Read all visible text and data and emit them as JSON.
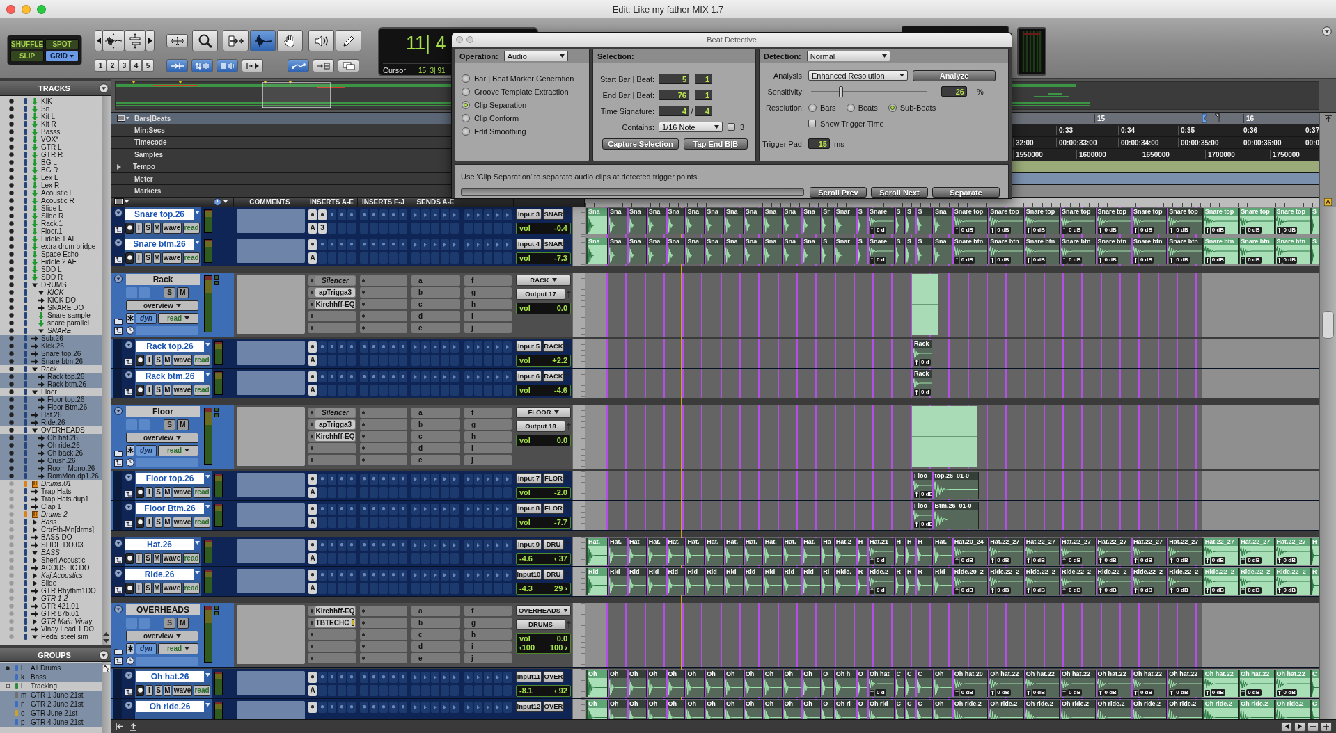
{
  "window": {
    "title": "Edit: Like my father MIX 1.7"
  },
  "toolbar": {
    "edit_modes": [
      {
        "label": "SHUFFLE",
        "selected": false
      },
      {
        "label": "SPOT",
        "selected": false
      },
      {
        "label": "SLIP",
        "selected": false
      },
      {
        "label": "GRID",
        "selected": true
      }
    ],
    "zoom_presets": [
      "1",
      "2",
      "3",
      "4",
      "5"
    ],
    "tools": [
      {
        "kind": "zoom",
        "selected": false
      },
      {
        "kind": "trim",
        "selected": false
      },
      {
        "kind": "select",
        "selected": true
      },
      {
        "kind": "grab",
        "selected": false
      },
      {
        "kind": "scrub",
        "selected": false
      },
      {
        "kind": "pencil",
        "selected": false
      }
    ],
    "options": [
      {
        "kind": "tab",
        "on": true
      },
      {
        "kind": "nudge",
        "on": true
      },
      {
        "kind": "spread",
        "on": true
      },
      {
        "kind": "insert",
        "on": false
      },
      {
        "kind": "link",
        "on": true
      },
      {
        "kind": "arrow-box",
        "on": false
      },
      {
        "kind": "windows",
        "on": false
      }
    ],
    "counter": {
      "main": "11| 4",
      "label": "Cursor",
      "cursor": "15| 3| 91"
    }
  },
  "tracks_panel": {
    "title": "TRACKS",
    "items": [
      {
        "name": "KiK",
        "kind": "aux",
        "shown": true,
        "selected": false,
        "inactive": false
      },
      {
        "name": "Sn",
        "kind": "aux",
        "shown": true,
        "selected": false,
        "inactive": false
      },
      {
        "name": "Kit L",
        "kind": "aux",
        "shown": true,
        "selected": false,
        "inactive": false
      },
      {
        "name": "Kit R",
        "kind": "aux",
        "shown": true,
        "selected": false,
        "inactive": false
      },
      {
        "name": "Basss",
        "kind": "aux",
        "shown": true,
        "selected": false,
        "inactive": false
      },
      {
        "name": "VOX*",
        "kind": "aux",
        "shown": true,
        "selected": false,
        "inactive": false
      },
      {
        "name": "GTR L",
        "kind": "aux",
        "shown": true,
        "selected": false,
        "inactive": false
      },
      {
        "name": "GTR R",
        "kind": "aux",
        "shown": true,
        "selected": false,
        "inactive": false
      },
      {
        "name": "BG L",
        "kind": "aux",
        "shown": true,
        "selected": false,
        "inactive": false
      },
      {
        "name": "BG R",
        "kind": "aux",
        "shown": true,
        "selected": false,
        "inactive": false
      },
      {
        "name": "Lex L",
        "kind": "aux",
        "shown": true,
        "selected": false,
        "inactive": false
      },
      {
        "name": "Lex R",
        "kind": "aux",
        "shown": true,
        "selected": false,
        "inactive": false
      },
      {
        "name": "Acoustic L",
        "kind": "aux",
        "shown": true,
        "selected": false,
        "inactive": false
      },
      {
        "name": "Acoustic R",
        "kind": "aux",
        "shown": true,
        "selected": false,
        "inactive": false
      },
      {
        "name": "Slide L",
        "kind": "aux",
        "shown": true,
        "selected": false,
        "inactive": false
      },
      {
        "name": "Slide R",
        "kind": "aux",
        "shown": true,
        "selected": false,
        "inactive": false
      },
      {
        "name": "Rack.1",
        "kind": "aux",
        "shown": true,
        "selected": false,
        "inactive": false
      },
      {
        "name": "Floor.1",
        "kind": "aux",
        "shown": true,
        "selected": false,
        "inactive": false
      },
      {
        "name": "Fiddle 1 AF",
        "kind": "aux",
        "shown": true,
        "selected": false,
        "inactive": false
      },
      {
        "name": "extra drum bridge",
        "kind": "aux",
        "shown": true,
        "selected": false,
        "inactive": false
      },
      {
        "name": "Space Echo",
        "kind": "aux",
        "shown": true,
        "selected": false,
        "inactive": false
      },
      {
        "name": "Fiddle 2 AF",
        "kind": "aux",
        "shown": true,
        "selected": false,
        "inactive": false
      },
      {
        "name": "SDD L",
        "kind": "aux",
        "shown": true,
        "selected": false,
        "inactive": false
      },
      {
        "name": "SDD R",
        "kind": "aux",
        "shown": true,
        "selected": false,
        "inactive": false
      },
      {
        "name": "DRUMS",
        "kind": "folder",
        "shown": true,
        "selected": false,
        "inactive": false,
        "expanded": true,
        "children": [
          {
            "name": "KICK",
            "kind": "folder",
            "shown": true,
            "selected": false,
            "inactive": true,
            "expanded": true
          },
          {
            "name": "KICK DO",
            "kind": "audio",
            "shown": true,
            "selected": false,
            "inactive": false
          },
          {
            "name": "SNARE DO",
            "kind": "audio",
            "shown": true,
            "selected": false,
            "inactive": false
          },
          {
            "name": "Snare sample",
            "kind": "aux",
            "shown": true,
            "selected": false,
            "inactive": false
          },
          {
            "name": "snare parallel",
            "kind": "aux",
            "shown": true,
            "selected": false,
            "inactive": false
          },
          {
            "name": "SNARE",
            "kind": "folder",
            "shown": true,
            "selected": false,
            "inactive": true,
            "expanded": true
          }
        ]
      },
      {
        "name": "Sub.26",
        "kind": "audio",
        "shown": true,
        "selected": true,
        "inactive": false
      },
      {
        "name": "Kick.26",
        "kind": "audio",
        "shown": true,
        "selected": true,
        "inactive": false
      },
      {
        "name": "Snare top.26",
        "kind": "audio",
        "shown": true,
        "selected": true,
        "inactive": false
      },
      {
        "name": "Snare btm.26",
        "kind": "audio",
        "shown": true,
        "selected": true,
        "inactive": false
      },
      {
        "name": "Rack",
        "kind": "folder",
        "shown": true,
        "selected": false,
        "inactive": false,
        "expanded": true,
        "children": [
          {
            "name": "Rack top.26",
            "kind": "audio",
            "shown": true,
            "selected": true,
            "inactive": false
          },
          {
            "name": "Rack btm.26",
            "kind": "audio",
            "shown": true,
            "selected": true,
            "inactive": false
          }
        ]
      },
      {
        "name": "Floor",
        "kind": "folder",
        "shown": true,
        "selected": false,
        "inactive": false,
        "expanded": true,
        "children": [
          {
            "name": "Floor top.26",
            "kind": "audio",
            "shown": true,
            "selected": true,
            "inactive": false
          },
          {
            "name": "Floor Btm.26",
            "kind": "audio",
            "shown": true,
            "selected": true,
            "inactive": false
          }
        ]
      },
      {
        "name": "Hat.26",
        "kind": "audio",
        "shown": true,
        "selected": true,
        "inactive": false
      },
      {
        "name": "Ride.26",
        "kind": "audio",
        "shown": true,
        "selected": true,
        "inactive": false
      },
      {
        "name": "OVERHEADS",
        "kind": "folder",
        "shown": true,
        "selected": false,
        "inactive": false,
        "expanded": true,
        "children": [
          {
            "name": "Oh hat.26",
            "kind": "audio",
            "shown": true,
            "selected": true,
            "inactive": false
          },
          {
            "name": "Oh ride.26",
            "kind": "audio",
            "shown": true,
            "selected": true,
            "inactive": false
          },
          {
            "name": "Oh back.26",
            "kind": "audio",
            "shown": true,
            "selected": true,
            "inactive": false
          },
          {
            "name": "Crush.26",
            "kind": "audio",
            "shown": true,
            "selected": true,
            "inactive": false
          },
          {
            "name": "Room Mono.26",
            "kind": "audio",
            "shown": true,
            "selected": true,
            "inactive": false
          },
          {
            "name": "RomMon.dp1.26",
            "kind": "audio",
            "shown": true,
            "selected": true,
            "inactive": false
          }
        ]
      },
      {
        "name": "Drums.01",
        "kind": "instrument",
        "shown": false,
        "selected": false,
        "inactive": true
      },
      {
        "name": "Trap Hats",
        "kind": "audio",
        "shown": false,
        "selected": false,
        "inactive": false
      },
      {
        "name": "Trap Hats.dup1",
        "kind": "audio",
        "shown": false,
        "selected": false,
        "inactive": false
      },
      {
        "name": "Clap 1",
        "kind": "audio",
        "shown": false,
        "selected": false,
        "inactive": false
      },
      {
        "name": "Drums 2",
        "kind": "instrument",
        "shown": false,
        "selected": false,
        "inactive": true
      },
      {
        "name": "Bass",
        "kind": "folder",
        "shown": false,
        "selected": false,
        "inactive": true,
        "expanded": false
      },
      {
        "name": "CrtrFth-Mn[drms]",
        "kind": "folder",
        "shown": false,
        "selected": false,
        "inactive": false,
        "expanded": false
      },
      {
        "name": "BASS DO",
        "kind": "audio",
        "shown": false,
        "selected": false,
        "inactive": false
      },
      {
        "name": "SLIDE DO.03",
        "kind": "audio",
        "shown": false,
        "selected": false,
        "inactive": false
      },
      {
        "name": "BASS",
        "kind": "folder",
        "shown": false,
        "selected": false,
        "inactive": true,
        "expanded": true
      },
      {
        "name": "Sheri Acoustic",
        "kind": "folder",
        "shown": false,
        "selected": false,
        "inactive": false,
        "expanded": false
      },
      {
        "name": "ACOUSTIC DO",
        "kind": "audio",
        "shown": false,
        "selected": false,
        "inactive": false
      },
      {
        "name": "Kaj Acoustics",
        "kind": "folder",
        "shown": false,
        "selected": false,
        "inactive": true,
        "expanded": false
      },
      {
        "name": "Slide",
        "kind": "folder",
        "shown": false,
        "selected": false,
        "inactive": false,
        "expanded": false
      },
      {
        "name": "GTR Rhythm1DO",
        "kind": "audio",
        "shown": false,
        "selected": false,
        "inactive": false
      },
      {
        "name": "GTR 1-2",
        "kind": "folder",
        "shown": false,
        "selected": false,
        "inactive": true,
        "expanded": false
      },
      {
        "name": "GTR 421.01",
        "kind": "audio",
        "shown": false,
        "selected": false,
        "inactive": false
      },
      {
        "name": "GTR 87b.01",
        "kind": "audio",
        "shown": false,
        "selected": false,
        "inactive": false
      },
      {
        "name": "GTR Main Vinay",
        "kind": "folder",
        "shown": false,
        "selected": false,
        "inactive": true,
        "expanded": false
      },
      {
        "name": "Vinay Lead 1 DO",
        "kind": "audio",
        "shown": false,
        "selected": false,
        "inactive": false
      },
      {
        "name": "Pedal steel sim",
        "kind": "folder",
        "shown": false,
        "selected": false,
        "inactive": false,
        "expanded": true
      }
    ]
  },
  "groups_panel": {
    "title": "GROUPS",
    "items": [
      {
        "letter": "i",
        "name": "All Drums",
        "selected": true,
        "kind": "active",
        "color": "#3d6fc0"
      },
      {
        "letter": "k",
        "name": "Bass",
        "selected": true,
        "kind": "plain",
        "color": "#3d6fc0"
      },
      {
        "letter": "l",
        "name": "Tracking",
        "selected": false,
        "kind": "inactive",
        "color": "#2e8b3e"
      },
      {
        "letter": "m",
        "name": "GTR 1 June 21st",
        "selected": true,
        "kind": "plain",
        "color": "#707070"
      },
      {
        "letter": "n",
        "name": "GTR 2 June 21st",
        "selected": true,
        "kind": "plain",
        "color": "#3d6fc0"
      },
      {
        "letter": "o",
        "name": "GTR June 21st",
        "selected": true,
        "kind": "plain",
        "color": "#c9a227"
      },
      {
        "letter": "p",
        "name": "GTR 4 June 21st",
        "selected": true,
        "kind": "plain",
        "color": "#3d6fc0"
      }
    ]
  },
  "rulers": [
    {
      "label": "Bars|Beats",
      "kind": "bars",
      "selected": true,
      "ticks": [
        "15",
        "16"
      ]
    },
    {
      "label": "Min:Secs",
      "kind": "minsecs",
      "selected": false,
      "ticks": [
        "0:33",
        "0:34",
        "0:35",
        "0:36",
        "0:37"
      ]
    },
    {
      "label": "Timecode",
      "kind": "timecode",
      "selected": false,
      "ticks": [
        "32:00",
        "00:00:33:00",
        "00:00:34:00",
        "00:00:35:00",
        "00:00:36:00",
        "00:0"
      ]
    },
    {
      "label": "Samples",
      "kind": "samples",
      "selected": false,
      "ticks": [
        "1550000",
        "1600000",
        "1650000",
        "1700000",
        "1750000"
      ]
    },
    {
      "label": "Tempo",
      "kind": "tempo",
      "selected": false
    },
    {
      "label": "Meter",
      "kind": "meter",
      "selected": false
    },
    {
      "label": "Markers",
      "kind": "markers",
      "selected": false
    }
  ],
  "columns": [
    "COMMENTS",
    "INSERTS A-E",
    "INSERTS F-J",
    "SENDS A-E"
  ],
  "tracks": [
    {
      "kind": "audio",
      "name": "Snare top.26",
      "selected": true,
      "armed": false,
      "buttons": [
        {
          "label": "I",
          "on": false
        },
        {
          "label": "S",
          "on": false
        },
        {
          "label": "M",
          "on": false
        }
      ],
      "view": "wave",
      "automation": "read",
      "insert_marks": [
        "A",
        "3"
      ],
      "input": "Input 3",
      "output": "SNAR",
      "volume_label": "vol",
      "volume": "-0.4",
      "clips": [
        {
          "label": "Sna"
        },
        {
          "label": "Sna"
        },
        {
          "label": "Sna"
        },
        {
          "label": "Sna"
        },
        {
          "label": "Sna"
        },
        {
          "label": "Sna"
        },
        {
          "label": "Sna"
        },
        {
          "label": "Sna"
        },
        {
          "label": "Sna"
        },
        {
          "label": "Sna"
        },
        {
          "label": "Sna"
        },
        {
          "label": "Sna"
        },
        {
          "label": "Sr"
        },
        {
          "label": "Snar"
        },
        {
          "label": "S"
        },
        {
          "label": "Snare",
          "gain": "0 d"
        },
        {
          "label": "S"
        },
        {
          "label": "S"
        },
        {
          "label": "S"
        },
        {
          "label": "Sna"
        },
        {
          "label": "Snare top",
          "gain": "0 dB"
        },
        {
          "label": "Snare top",
          "gain": "0 dB"
        },
        {
          "label": "Snare top",
          "gain": "0 dB"
        },
        {
          "label": "Snare top",
          "gain": "0 dB"
        },
        {
          "label": "Snare top",
          "gain": "0 dB"
        },
        {
          "label": "Snare top",
          "gain": "0 dB"
        },
        {
          "label": "Snare top",
          "gain": "0 dB"
        },
        {
          "label": "Snare top",
          "gain": "0 dB"
        },
        {
          "label": "Snare top",
          "gain": "0 dB"
        },
        {
          "label": "Snare top",
          "gain": "0 dB"
        },
        {
          "label": "S"
        }
      ]
    },
    {
      "kind": "audio",
      "name": "Snare btm.26",
      "selected": true,
      "armed": false,
      "buttons": [
        {
          "label": "I",
          "on": false
        },
        {
          "label": "S",
          "on": false
        },
        {
          "label": "M",
          "on": false
        }
      ],
      "view": "wave",
      "automation": "read",
      "insert_marks": [
        "A"
      ],
      "input": "Input 4",
      "output": "SNAR",
      "volume_label": "vol",
      "volume": "-7.3",
      "clips": [
        {
          "label": "Sna"
        },
        {
          "label": "Sna"
        },
        {
          "label": "Sna"
        },
        {
          "label": "Sna"
        },
        {
          "label": "Sna"
        },
        {
          "label": "Sna"
        },
        {
          "label": "Sna"
        },
        {
          "label": "Sna"
        },
        {
          "label": "Sna"
        },
        {
          "label": "Sna"
        },
        {
          "label": "Sna"
        },
        {
          "label": "Sna"
        },
        {
          "label": "S"
        },
        {
          "label": "Snar"
        },
        {
          "label": "S"
        },
        {
          "label": "Snare",
          "gain": "0 d"
        },
        {
          "label": "S"
        },
        {
          "label": "S"
        },
        {
          "label": "S"
        },
        {
          "label": "Sna"
        },
        {
          "label": "Snare btn",
          "gain": "0 dB"
        },
        {
          "label": "Snare btn",
          "gain": "0 dB"
        },
        {
          "label": "Snare btn",
          "gain": "0 dB"
        },
        {
          "label": "Snare btn",
          "gain": "0 dB"
        },
        {
          "label": "Snare btn",
          "gain": "0 dB"
        },
        {
          "label": "Snare btn",
          "gain": "0 dB"
        },
        {
          "label": "Snare btn",
          "gain": "0 dB"
        },
        {
          "label": "Snare btn",
          "gain": "0 dB"
        },
        {
          "label": "Snare btn",
          "gain": "0 dB"
        },
        {
          "label": "Snare btn",
          "gain": "0 dB"
        },
        {
          "label": "S"
        }
      ]
    },
    {
      "kind": "folder",
      "name": "Rack",
      "selected": false,
      "buttons": [
        {
          "label": "S",
          "on": false
        },
        {
          "label": "M",
          "on": false
        }
      ],
      "view": "overview",
      "mode": "dyn",
      "automation": "read",
      "inserts": [
        {
          "name": "Silencer",
          "bypassed": true,
          "meter": false
        },
        {
          "name": "apTrigga3",
          "bypassed": false,
          "meter": false
        },
        {
          "name": "Kirchhff-EQ",
          "bypassed": false,
          "meter": false
        }
      ],
      "sends_ae": [
        "a",
        "b",
        "c",
        "d",
        "e"
      ],
      "sends_fj": [
        "f",
        "g",
        "h",
        "i",
        "j"
      ],
      "output_bus": "RACK",
      "output": "Output 17",
      "volume_label": "vol",
      "volume": "0.0",
      "clips": [
        {
          "kind": "summary"
        }
      ],
      "children": [
        {
          "kind": "audio",
          "name": "Rack top.26",
          "selected": true,
          "armed": false,
          "buttons": [
            {
              "label": "I",
              "on": false
            },
            {
              "label": "S",
              "on": false
            },
            {
              "label": "M",
              "on": false
            }
          ],
          "view": "wave",
          "automation": "read",
          "insert_marks": [
            "A"
          ],
          "input": "Input 5",
          "output": "RACK",
          "volume_label": "vol",
          "volume": "+2.2",
          "clips": [
            {
              "label": "Rack",
              "gain": "0 d"
            }
          ]
        },
        {
          "kind": "audio",
          "name": "Rack btm.26",
          "selected": true,
          "armed": false,
          "buttons": [
            {
              "label": "I",
              "on": false
            },
            {
              "label": "S",
              "on": false
            },
            {
              "label": "M",
              "on": false
            }
          ],
          "view": "wave",
          "automation": "read",
          "insert_marks": [
            "A"
          ],
          "input": "Input 6",
          "output": "RACK",
          "volume_label": "vol",
          "volume": "-4.6",
          "clips": [
            {
              "label": "Rack",
              "gain": "0 d"
            }
          ]
        }
      ]
    },
    {
      "kind": "folder",
      "name": "Floor",
      "selected": false,
      "buttons": [
        {
          "label": "S",
          "on": false
        },
        {
          "label": "M",
          "on": false
        }
      ],
      "view": "overview",
      "mode": "dyn",
      "automation": "read",
      "inserts": [
        {
          "name": "Silencer",
          "bypassed": true,
          "meter": false
        },
        {
          "name": "apTrigga3",
          "bypassed": false,
          "meter": false
        },
        {
          "name": "Kirchhff-EQ",
          "bypassed": false,
          "meter": false
        }
      ],
      "sends_ae": [
        "a",
        "b",
        "c",
        "d",
        "e"
      ],
      "sends_fj": [
        "f",
        "g",
        "h",
        "i",
        "j"
      ],
      "output_bus": "FLOOR",
      "output": "Output 18",
      "volume_label": "vol",
      "volume": "0.0",
      "clips": [
        {
          "kind": "summary"
        },
        {
          "kind": "summary"
        }
      ],
      "children": [
        {
          "kind": "audio",
          "name": "Floor top.26",
          "selected": true,
          "armed": false,
          "buttons": [
            {
              "label": "I",
              "on": false
            },
            {
              "label": "S",
              "on": false
            },
            {
              "label": "M",
              "on": false
            }
          ],
          "view": "wave",
          "automation": "read",
          "insert_marks": [
            "A"
          ],
          "input": "Input 7",
          "output": "FLOR",
          "volume_label": "vol",
          "volume": "-2.0",
          "clips": [
            {
              "label": "Floo",
              "gain": "0 dB"
            },
            {
              "label": "top.26_01-0"
            }
          ]
        },
        {
          "kind": "audio",
          "name": "Floor Btm.26",
          "selected": true,
          "armed": false,
          "buttons": [
            {
              "label": "I",
              "on": false
            },
            {
              "label": "S",
              "on": false
            },
            {
              "label": "M",
              "on": false
            }
          ],
          "view": "wave",
          "automation": "read",
          "insert_marks": [
            "A"
          ],
          "input": "Input 8",
          "output": "FLOR",
          "volume_label": "vol",
          "volume": "-7.7",
          "clips": [
            {
              "label": "Floo",
              "gain": "0 dB"
            },
            {
              "label": "Btm.26_01-0"
            }
          ]
        }
      ]
    },
    {
      "kind": "audio",
      "name": "Hat.26",
      "selected": true,
      "armed": false,
      "buttons": [
        {
          "label": "I",
          "on": false
        },
        {
          "label": "S",
          "on": false
        },
        {
          "label": "M",
          "on": false
        }
      ],
      "view": "wave",
      "automation": "read",
      "insert_marks": [
        "A"
      ],
      "input": "Input 9",
      "output": "DRU",
      "volume": "-4.6",
      "pan": [
        "‹ 37"
      ],
      "clips": [
        {
          "label": "Hat."
        },
        {
          "label": "Hat."
        },
        {
          "label": "Hat"
        },
        {
          "label": "Hat."
        },
        {
          "label": "Hat."
        },
        {
          "label": "Hat."
        },
        {
          "label": "Hat."
        },
        {
          "label": "Hat."
        },
        {
          "label": "Hat."
        },
        {
          "label": "Hat."
        },
        {
          "label": "Hat."
        },
        {
          "label": "Hat."
        },
        {
          "label": "Ha"
        },
        {
          "label": "Hat.2"
        },
        {
          "label": "H"
        },
        {
          "label": "Hat.21",
          "gain": "0 d"
        },
        {
          "label": "H"
        },
        {
          "label": "H"
        },
        {
          "label": "H"
        },
        {
          "label": "Hat."
        },
        {
          "label": "Hat.20_24",
          "gain": "0 dB"
        },
        {
          "label": "Hat.22_27",
          "gain": "0 dB"
        },
        {
          "label": "Hat.22_27",
          "gain": "0 dB"
        },
        {
          "label": "Hat.22_27",
          "gain": "0 dB"
        },
        {
          "label": "Hat.22_27",
          "gain": "0 dB"
        },
        {
          "label": "Hat.22_27",
          "gain": "0 dB"
        },
        {
          "label": "Hat.22_27",
          "gain": "0 dB"
        },
        {
          "label": "Hat.22_27",
          "gain": "0 dB"
        },
        {
          "label": "Hat.22_27",
          "gain": "0 dB"
        },
        {
          "label": "Hat.22_27",
          "gain": "0 dB"
        },
        {
          "label": "H"
        }
      ]
    },
    {
      "kind": "audio",
      "name": "Ride.26",
      "selected": true,
      "armed": false,
      "buttons": [
        {
          "label": "I",
          "on": false
        },
        {
          "label": "S",
          "on": false
        },
        {
          "label": "M",
          "on": false
        }
      ],
      "view": "wave",
      "automation": "read",
      "insert_marks": [
        "A"
      ],
      "input": "Input10",
      "output": "DRU",
      "volume": "-4.3",
      "pan": [
        "29 ›"
      ],
      "clips": [
        {
          "label": "Rid"
        },
        {
          "label": "Rid"
        },
        {
          "label": "Rid"
        },
        {
          "label": "Rid"
        },
        {
          "label": "Rid"
        },
        {
          "label": "Rid"
        },
        {
          "label": "Rid"
        },
        {
          "label": "Rid"
        },
        {
          "label": "Rid"
        },
        {
          "label": "Rid"
        },
        {
          "label": "Rid"
        },
        {
          "label": "Rid"
        },
        {
          "label": "Ri"
        },
        {
          "label": "Ride."
        },
        {
          "label": "R"
        },
        {
          "label": "Ride.2",
          "gain": "0 d"
        },
        {
          "label": "R"
        },
        {
          "label": "R"
        },
        {
          "label": "R"
        },
        {
          "label": "Rid"
        },
        {
          "label": "Ride.20_2",
          "gain": "0 dB"
        },
        {
          "label": "Ride.22_2",
          "gain": "0 dB"
        },
        {
          "label": "Ride.22_2",
          "gain": "0 dB"
        },
        {
          "label": "Ride.22_2",
          "gain": "0 dB"
        },
        {
          "label": "Ride.22_2",
          "gain": "0 dB"
        },
        {
          "label": "Ride.22_2",
          "gain": "0 dB"
        },
        {
          "label": "Ride.22_2",
          "gain": "0 dB"
        },
        {
          "label": "Ride.22_2",
          "gain": "0 dB"
        },
        {
          "label": "Ride.22_2",
          "gain": "0 dB"
        },
        {
          "label": "Ride.22_2",
          "gain": "0 dB"
        },
        {
          "label": "R"
        }
      ]
    },
    {
      "kind": "folder",
      "name": "OVERHEADS",
      "selected": false,
      "buttons": [
        {
          "label": "S",
          "on": false
        },
        {
          "label": "M",
          "on": false
        }
      ],
      "view": "overview",
      "mode": "dyn",
      "automation": "read",
      "inserts": [
        {
          "name": "Kirchhff-EQ",
          "bypassed": false,
          "meter": false
        },
        {
          "name": "TBTECHC",
          "bypassed": false,
          "meter": true
        }
      ],
      "sends_ae": [
        "a",
        "b",
        "c",
        "d",
        "e"
      ],
      "sends_fj": [
        "f",
        "g",
        "h",
        "i",
        "j"
      ],
      "output_bus": "OVERHEADS",
      "output": "DRUMS",
      "volume_label": "vol",
      "volume": "0.0",
      "pan": [
        "‹100",
        "100 ›"
      ],
      "children": [
        {
          "kind": "audio",
          "name": "Oh hat.26",
          "selected": true,
          "armed": false,
          "buttons": [
            {
              "label": "I",
              "on": false
            },
            {
              "label": "S",
              "on": false
            },
            {
              "label": "M",
              "on": false
            }
          ],
          "view": "wave",
          "automation": "read",
          "insert_marks": [
            "A"
          ],
          "input": "Input11",
          "output": "OVER",
          "volume": "-8.1",
          "pan": [
            "‹ 92"
          ],
          "clips": [
            {
              "label": "Oh"
            },
            {
              "label": "Oh"
            },
            {
              "label": "Oh"
            },
            {
              "label": "Oh"
            },
            {
              "label": "Oh"
            },
            {
              "label": "Oh"
            },
            {
              "label": "Oh"
            },
            {
              "label": "Oh"
            },
            {
              "label": "Oh"
            },
            {
              "label": "Oh"
            },
            {
              "label": "Oh"
            },
            {
              "label": "Oh"
            },
            {
              "label": "O"
            },
            {
              "label": "Oh h"
            },
            {
              "label": "O"
            },
            {
              "label": "Oh hat",
              "gain": "0 d"
            },
            {
              "label": "C"
            },
            {
              "label": "C"
            },
            {
              "label": "C"
            },
            {
              "label": "Oh"
            },
            {
              "label": "Oh hat.20",
              "gain": "0 dB"
            },
            {
              "label": "Oh hat.22",
              "gain": "0 dB"
            },
            {
              "label": "Oh hat.22",
              "gain": "0 dB"
            },
            {
              "label": "Oh hat.22",
              "gain": "0 dB"
            },
            {
              "label": "Oh hat.22",
              "gain": "0 dB"
            },
            {
              "label": "Oh hat.22",
              "gain": "0 dB"
            },
            {
              "label": "Oh hat.22",
              "gain": "0 dB"
            },
            {
              "label": "Oh hat.22",
              "gain": "0 dB"
            },
            {
              "label": "Oh hat.22",
              "gain": "0 dB"
            },
            {
              "label": "Oh hat.22",
              "gain": "0 dB"
            },
            {
              "label": "C"
            }
          ]
        },
        {
          "kind": "audio",
          "name": "Oh ride.26",
          "selected": true,
          "input": "Input12",
          "output": "OVER",
          "clips": [
            {
              "label": "Oh"
            },
            {
              "label": "Oh"
            },
            {
              "label": "Oh"
            },
            {
              "label": "Oh"
            },
            {
              "label": "Oh"
            },
            {
              "label": "Oh"
            },
            {
              "label": "Oh"
            },
            {
              "label": "Oh"
            },
            {
              "label": "Oh"
            },
            {
              "label": "Oh"
            },
            {
              "label": "Oh"
            },
            {
              "label": "Oh"
            },
            {
              "label": "O"
            },
            {
              "label": "Oh ri"
            },
            {
              "label": "O"
            },
            {
              "label": "Oh rid"
            },
            {
              "label": "C"
            },
            {
              "label": "C"
            },
            {
              "label": "C"
            },
            {
              "label": "Oh"
            },
            {
              "label": "Oh ride.2"
            },
            {
              "label": "Oh ride.2"
            },
            {
              "label": "Oh ride.2"
            },
            {
              "label": "Oh ride.2"
            },
            {
              "label": "Oh ride.2"
            },
            {
              "label": "Oh ride.2"
            },
            {
              "label": "Oh ride.2"
            },
            {
              "label": "Oh ride.2"
            },
            {
              "label": "Oh ride.2"
            },
            {
              "label": "Oh ride.2"
            },
            {
              "label": "C"
            }
          ]
        }
      ]
    }
  ],
  "beat_detective": {
    "title": "Beat Detective",
    "operation": {
      "label": "Operation:",
      "value": "Audio",
      "options": [
        {
          "label": "Bar | Beat Marker Generation",
          "selected": false
        },
        {
          "label": "Groove Template Extraction",
          "selected": false
        },
        {
          "label": "Clip Separation",
          "selected": true
        },
        {
          "label": "Clip Conform",
          "selected": false
        },
        {
          "label": "Edit Smoothing",
          "selected": false
        }
      ]
    },
    "selection": {
      "label": "Selection:",
      "start": {
        "label": "Start Bar | Beat:",
        "bar": "5",
        "beat": "1"
      },
      "end": {
        "label": "End Bar | Beat:",
        "bar": "76",
        "beat": "1"
      },
      "time_signature": {
        "label": "Time Signature:",
        "upper": "4",
        "separator": "/",
        "lower": "4"
      },
      "contains": {
        "label": "Contains:",
        "value": "1/16 Note",
        "triplet": {
          "label": "3",
          "checked": false
        }
      },
      "buttons": [
        "Capture Selection",
        "Tap End B|B"
      ]
    },
    "detection": {
      "label": "Detection:",
      "value": "Normal",
      "analysis": {
        "label": "Analysis:",
        "value": "Enhanced Resolution"
      },
      "analyze_button": "Analyze",
      "sensitivity": {
        "label": "Sensitivity:",
        "level": 0.26,
        "value": "26",
        "unit": "%"
      },
      "resolution": {
        "label": "Resolution:",
        "options": [
          {
            "label": "Bars",
            "selected": false
          },
          {
            "label": "Beats",
            "selected": false
          },
          {
            "label": "Sub-Beats",
            "selected": true
          }
        ]
      },
      "show_trigger_time": {
        "label": "Show Trigger Time",
        "checked": false
      },
      "trigger_pad": {
        "label": "Trigger Pad:",
        "value": "15",
        "unit": "ms"
      }
    },
    "message": "Use 'Clip Separation' to separate audio clips at detected trigger points.",
    "progress": {
      "level": 0
    },
    "buttons": [
      "Scroll Prev",
      "Scroll Next",
      "Separate"
    ]
  }
}
